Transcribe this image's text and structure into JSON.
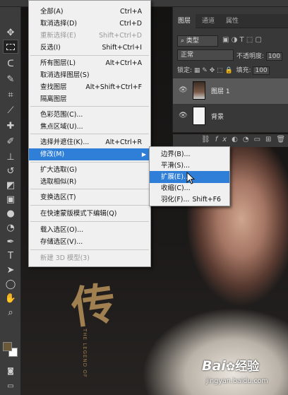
{
  "panel": {
    "tabs": [
      "图层",
      "通道",
      "属性"
    ],
    "kind_label": "类型",
    "blend_mode": "正常",
    "opacity_label": "不透明度:",
    "opacity_value": "100",
    "lock_label": "锁定:",
    "fill_label": "填充:",
    "fill_value": "100",
    "layers": [
      {
        "name": "图层 1",
        "selected": true
      },
      {
        "name": "背景",
        "selected": false
      }
    ],
    "footer_icons": [
      "link-icon",
      "fx-icon",
      "mask-icon",
      "adjustment-icon",
      "folder-icon",
      "new-layer-icon",
      "trash-icon"
    ]
  },
  "menu": {
    "items": [
      {
        "label": "全部(A)",
        "shortcut": "Ctrl+A"
      },
      {
        "label": "取消选择(D)",
        "shortcut": "Ctrl+D"
      },
      {
        "label": "重新选择(E)",
        "shortcut": "Shift+Ctrl+D",
        "disabled": true
      },
      {
        "label": "反选(I)",
        "shortcut": "Shift+Ctrl+I"
      },
      {
        "label": "所有图层(L)",
        "shortcut": "Alt+Ctrl+A"
      },
      {
        "label": "取消选择图层(S)",
        "shortcut": ""
      },
      {
        "label": "查找图层",
        "shortcut": "Alt+Shift+Ctrl+F"
      },
      {
        "label": "隔离图层",
        "shortcut": ""
      },
      {
        "label": "色彩范围(C)...",
        "shortcut": ""
      },
      {
        "label": "焦点区域(U)...",
        "shortcut": ""
      },
      {
        "label": "选择并遮住(K)...",
        "shortcut": "Alt+Ctrl+R"
      },
      {
        "label": "修改(M)",
        "shortcut": "",
        "highlighted": true
      },
      {
        "label": "扩大选取(G)",
        "shortcut": ""
      },
      {
        "label": "选取相似(R)",
        "shortcut": ""
      },
      {
        "label": "变换选区(T)",
        "shortcut": ""
      },
      {
        "label": "在快速蒙版模式下编辑(Q)",
        "shortcut": ""
      },
      {
        "label": "载入选区(O)...",
        "shortcut": ""
      },
      {
        "label": "存储选区(V)...",
        "shortcut": ""
      },
      {
        "label": "新建 3D 模型(3)",
        "shortcut": "",
        "disabled": true
      }
    ]
  },
  "submenu": {
    "items": [
      {
        "label": "边界(B)...",
        "shortcut": ""
      },
      {
        "label": "平滑(S)...",
        "shortcut": ""
      },
      {
        "label": "扩展(E)...",
        "shortcut": "",
        "highlighted": true
      },
      {
        "label": "收缩(C)...",
        "shortcut": ""
      },
      {
        "label": "羽化(F)...",
        "shortcut": "Shift+F6"
      }
    ]
  },
  "toolbar": {
    "tools": [
      "move-icon",
      "marquee-icon",
      "lasso-icon",
      "quick-select-icon",
      "crop-icon",
      "eyedropper-icon",
      "healing-icon",
      "brush-icon",
      "stamp-icon",
      "history-brush-icon",
      "eraser-icon",
      "gradient-icon",
      "blur-icon",
      "dodge-icon",
      "pen-icon",
      "type-icon",
      "path-select-icon",
      "shape-icon",
      "hand-icon",
      "zoom-icon"
    ],
    "foreground_color": "#6b5a3a",
    "background_color": "#ffffff"
  },
  "image": {
    "calligraphy": "传",
    "vertical_text": "THE LEGEND OF"
  },
  "watermark": {
    "brand": "Bai",
    "brand_suffix": "经验",
    "url": "jingyan.baidu.com"
  },
  "colors": {
    "menu_highlight": "#2f7fd8",
    "panel_bg": "#383838"
  }
}
